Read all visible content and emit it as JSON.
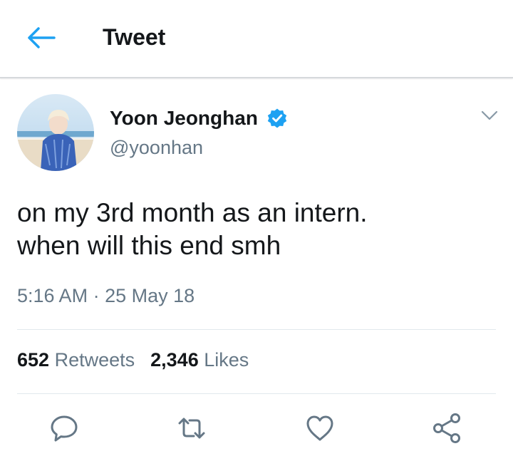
{
  "header": {
    "title": "Tweet"
  },
  "tweet": {
    "display_name": "Yoon Jeonghan",
    "handle": "@yoonhan",
    "text": "on my 3rd month as an intern.\nwhen will this end smh",
    "time": "5:16 AM",
    "separator": "·",
    "date": "25 May 18",
    "retweets_count": "652",
    "retweets_label": "Retweets",
    "likes_count": "2,346",
    "likes_label": "Likes"
  },
  "icons": {
    "back": "arrow-left-icon",
    "verified": "verified-badge-icon",
    "more": "chevron-down-icon",
    "reply": "reply-icon",
    "retweet": "retweet-icon",
    "like": "heart-icon",
    "share": "share-icon"
  },
  "colors": {
    "accent": "#1da1f2",
    "text": "#14171a",
    "muted": "#657786",
    "divider": "#e1e8ed"
  }
}
